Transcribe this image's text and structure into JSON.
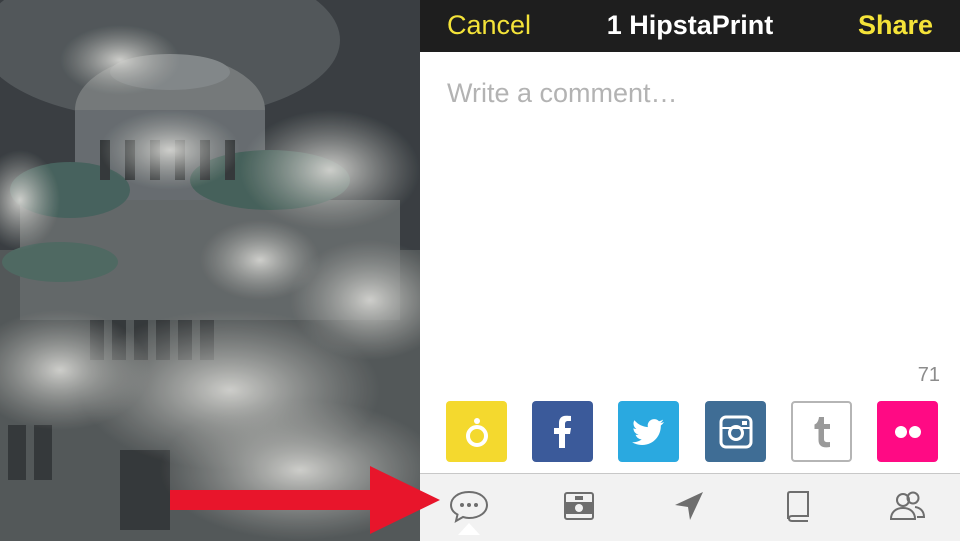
{
  "header": {
    "cancel_label": "Cancel",
    "title": "1 HipstaPrint",
    "share_label": "Share"
  },
  "comment": {
    "placeholder": "Write a comment…",
    "value": ""
  },
  "char_count": "71",
  "services": [
    {
      "name": "hipstamatic",
      "icon": "hipstamatic-icon",
      "color": "#f4d92e"
    },
    {
      "name": "facebook",
      "icon": "facebook-icon",
      "color": "#3b5a9a"
    },
    {
      "name": "twitter",
      "icon": "twitter-icon",
      "color": "#2aa9e0"
    },
    {
      "name": "instagram",
      "icon": "instagram-icon",
      "color": "#3f6d95"
    },
    {
      "name": "tumblr",
      "icon": "tumblr-icon",
      "color": "#ffffff"
    },
    {
      "name": "flickr",
      "icon": "flickr-icon",
      "color": "#ff0a84"
    }
  ],
  "tabs": [
    {
      "icon": "speech-bubble-icon",
      "selected": true
    },
    {
      "icon": "photo-frame-icon",
      "selected": false
    },
    {
      "icon": "location-arrow-icon",
      "selected": false
    },
    {
      "icon": "book-icon",
      "selected": false
    },
    {
      "icon": "people-icon",
      "selected": false
    }
  ],
  "colors": {
    "accent": "#f4e339",
    "topbar": "#1e1e1e",
    "annotation_arrow": "#e8152b"
  }
}
